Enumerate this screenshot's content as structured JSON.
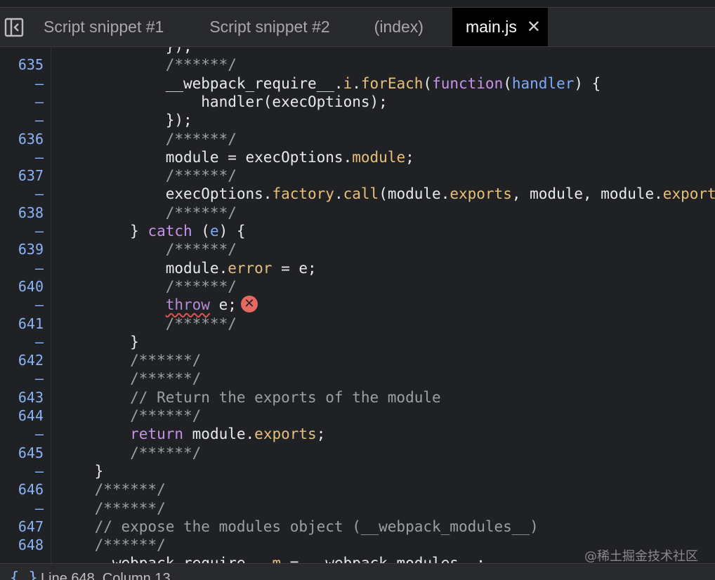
{
  "tabs": [
    {
      "label": "Script snippet #1",
      "active": false
    },
    {
      "label": "Script snippet #2",
      "active": false
    },
    {
      "label": "(index)",
      "active": false
    },
    {
      "label": "main.js",
      "active": true
    }
  ],
  "icons": {
    "sidebar_toggle": "sidebar-toggle-icon",
    "tab_close": "close-icon",
    "error": "error-x-icon",
    "status_braces": "curly-braces-icon"
  },
  "tab_close_glyph": "✕",
  "error_glyph": "✕",
  "status": {
    "braces": "{ }",
    "position": "Line 648, Column 13"
  },
  "watermark": "@稀土掘金技术社区",
  "gutter": [
    "",
    "635",
    "–",
    "–",
    "–",
    "636",
    "–",
    "637",
    "–",
    "638",
    "–",
    "639",
    "–",
    "640",
    "–",
    "641",
    "–",
    "642",
    "–",
    "643",
    "644",
    "–",
    "645",
    "–",
    "646",
    "–",
    "647",
    "648",
    ""
  ],
  "code_lines": [
    [
      [
        "plain",
        "            });"
      ]
    ],
    [
      [
        "comment",
        "            /******/"
      ]
    ],
    [
      [
        "plain",
        "            __webpack_require__."
      ],
      [
        "prop",
        "i"
      ],
      [
        "plain",
        "."
      ],
      [
        "prop",
        "forEach"
      ],
      [
        "plain",
        "("
      ],
      [
        "kw",
        "function"
      ],
      [
        "plain",
        "("
      ],
      [
        "param",
        "handler"
      ],
      [
        "plain",
        ") {"
      ]
    ],
    [
      [
        "plain",
        "                handler(execOptions);"
      ]
    ],
    [
      [
        "plain",
        "            });"
      ]
    ],
    [
      [
        "comment",
        "            /******/"
      ]
    ],
    [
      [
        "plain",
        "            module = execOptions."
      ],
      [
        "prop",
        "module"
      ],
      [
        "plain",
        ";"
      ]
    ],
    [
      [
        "comment",
        "            /******/"
      ]
    ],
    [
      [
        "plain",
        "            execOptions."
      ],
      [
        "prop",
        "factory"
      ],
      [
        "plain",
        "."
      ],
      [
        "prop",
        "call"
      ],
      [
        "plain",
        "(module."
      ],
      [
        "prop",
        "exports"
      ],
      [
        "plain",
        ", module, module."
      ],
      [
        "prop",
        "exports"
      ]
    ],
    [
      [
        "comment",
        "            /******/"
      ]
    ],
    [
      [
        "plain",
        "        } "
      ],
      [
        "kw",
        "catch"
      ],
      [
        "plain",
        " ("
      ],
      [
        "param",
        "e"
      ],
      [
        "plain",
        ") {"
      ]
    ],
    [
      [
        "comment",
        "            /******/"
      ]
    ],
    [
      [
        "plain",
        "            module."
      ],
      [
        "prop",
        "error"
      ],
      [
        "plain",
        " = e;"
      ]
    ],
    [
      [
        "comment",
        "            /******/"
      ]
    ],
    [
      [
        "plain",
        "            "
      ],
      [
        "throw",
        "throw"
      ],
      [
        "plain",
        " e;"
      ],
      [
        "error",
        ""
      ]
    ],
    [
      [
        "comment",
        "            /******/"
      ]
    ],
    [
      [
        "plain",
        "        }"
      ]
    ],
    [
      [
        "comment",
        "        /******/"
      ]
    ],
    [
      [
        "comment",
        "        /******/"
      ]
    ],
    [
      [
        "comment",
        "        // Return the exports of the module"
      ]
    ],
    [
      [
        "comment",
        "        /******/"
      ]
    ],
    [
      [
        "plain",
        "        "
      ],
      [
        "kw",
        "return"
      ],
      [
        "plain",
        " module."
      ],
      [
        "prop",
        "exports"
      ],
      [
        "plain",
        ";"
      ]
    ],
    [
      [
        "comment",
        "        /******/"
      ]
    ],
    [
      [
        "plain",
        "    }"
      ]
    ],
    [
      [
        "comment",
        "    /******/"
      ]
    ],
    [
      [
        "comment",
        "    /******/"
      ]
    ],
    [
      [
        "comment",
        "    // expose the modules object (__webpack_modules__)"
      ]
    ],
    [
      [
        "comment",
        "    /******/"
      ]
    ],
    [
      [
        "plain",
        "    __webpack_require__."
      ],
      [
        "prop",
        "m"
      ],
      [
        "plain",
        " = __webpack_modules__;"
      ]
    ]
  ]
}
